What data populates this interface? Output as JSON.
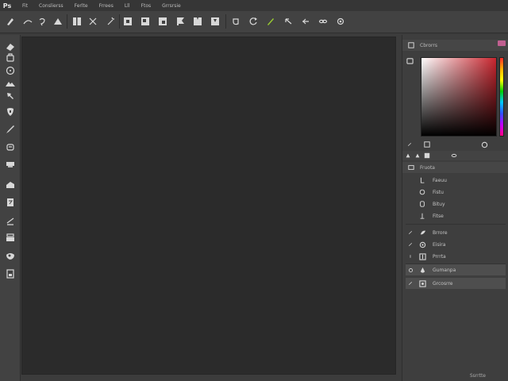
{
  "menubar": {
    "logo": "Ps",
    "items": [
      "Fit",
      "Conslierss",
      "Ferlte",
      "Frrees",
      "Lll",
      "Ftos",
      "Grrsrsie"
    ]
  },
  "options_bar": {
    "icons": [
      "brush-icon",
      "path-icon",
      "lasso-icon",
      "triangle-icon",
      "panel-icon",
      "cross-icon",
      "wand-icon",
      "frame-icon",
      "frame-icon",
      "frame-icon",
      "flag-icon",
      "crop-icon",
      "frame-icon",
      "shape-icon",
      "rotate-icon",
      "pen-icon",
      "arrow-icon",
      "link-icon",
      "gear-icon"
    ]
  },
  "toolbar": {
    "icons": [
      "eraser-icon",
      "stamp-icon",
      "circle-icon",
      "mountain-icon",
      "move-icon",
      "shield-icon",
      "brush-icon",
      "bucket-icon",
      "rectangle-icon",
      "paint-icon",
      "document-icon",
      "gradient-icon",
      "layers-icon",
      "palette-icon",
      "file-icon"
    ]
  },
  "color_panel": {
    "title": "Cbrorrs",
    "accent_hue": "#c8252e"
  },
  "layers_panel": {
    "title": "Fruota",
    "groups": [
      {
        "items": [
          "Faeuu",
          "Fistu",
          "Bituy",
          "Fitse"
        ]
      },
      {
        "items": [
          "Brrore",
          "Eisira",
          "Prrrta"
        ]
      }
    ],
    "selected_items": [
      "Gumanpa",
      "Grcosrre"
    ]
  },
  "status": {
    "text": "Ssrrtte"
  },
  "colors": {
    "background": "#3c3c3c",
    "canvas": "#2b2b2b",
    "accent_green": "#9acd32"
  }
}
